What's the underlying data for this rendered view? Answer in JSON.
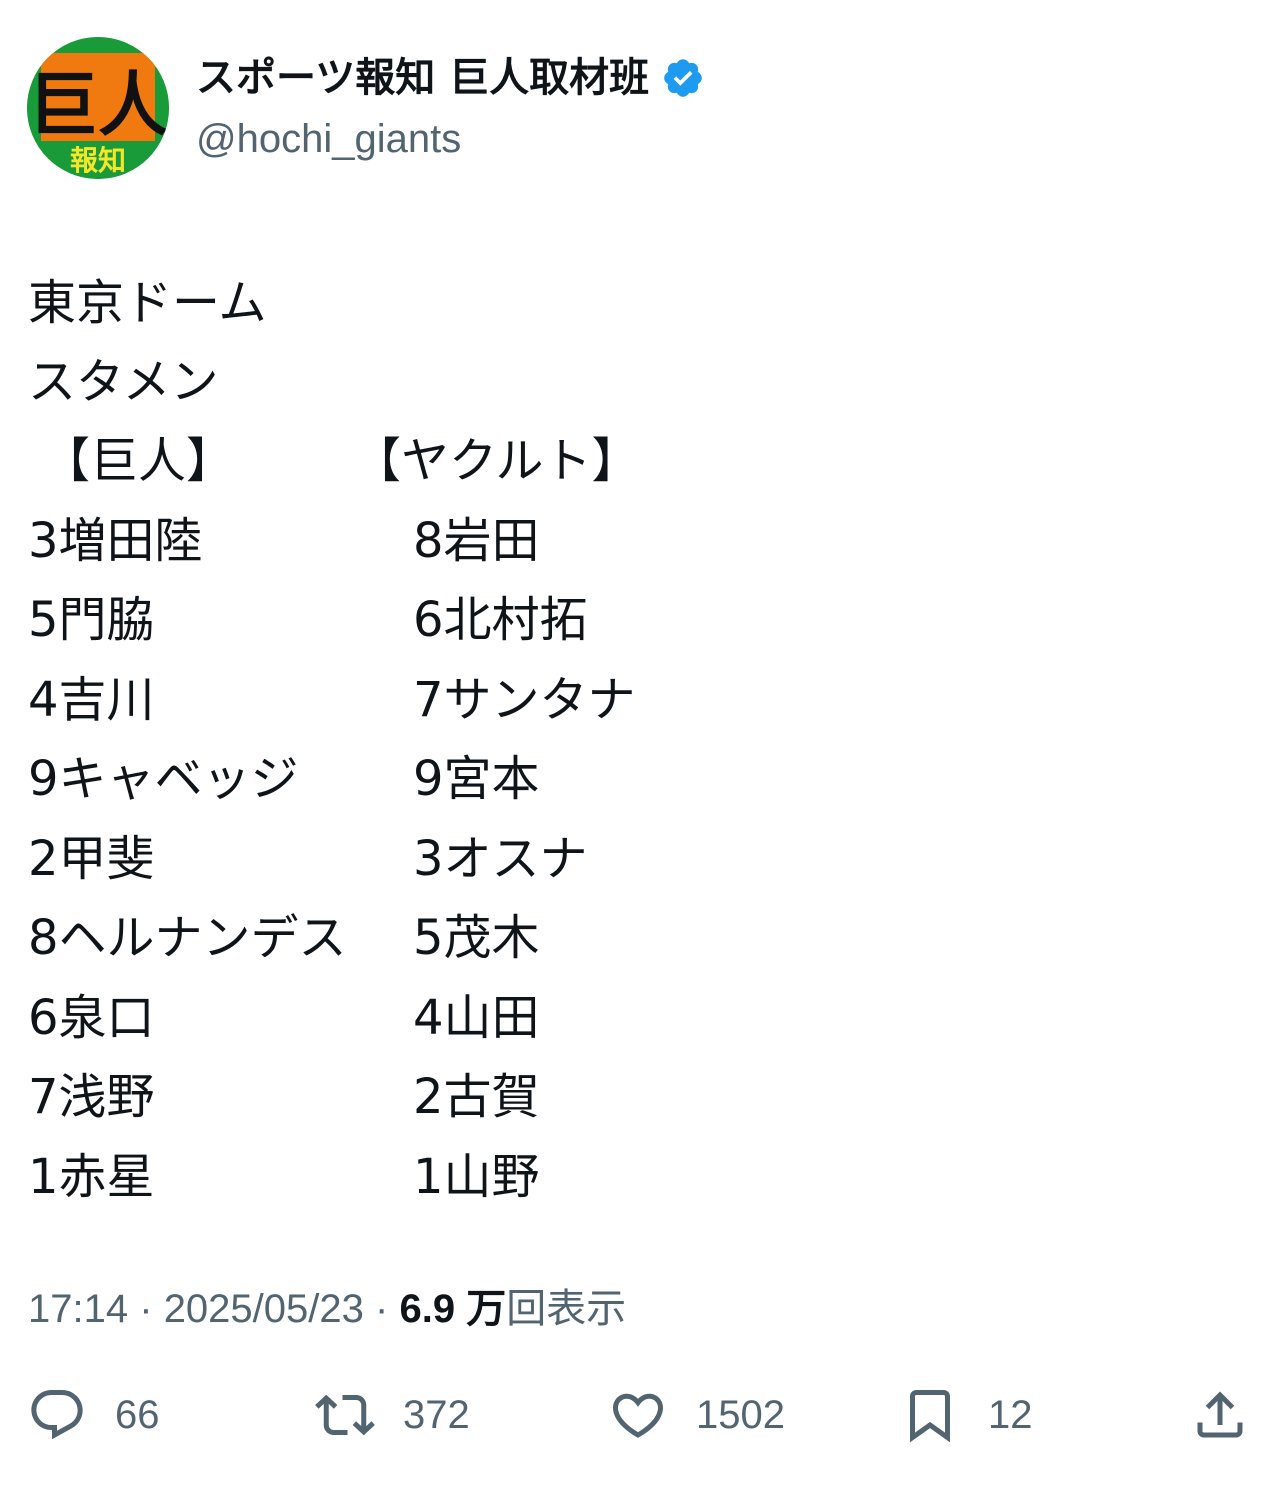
{
  "author": {
    "display_name": "スポーツ報知 巨人取材班",
    "handle": "@hochi_giants",
    "avatar_text_top": "巨人",
    "avatar_text_bottom": "報知",
    "verified": true,
    "verified_color": "#1d9bf0"
  },
  "post": {
    "lines": [
      "東京ドーム",
      "スタメン"
    ],
    "lineup": {
      "home_header": "【巨人】",
      "away_header": "【ヤクルト】",
      "home": [
        "3増田陸",
        "5門脇",
        "4吉川",
        "9キャベッジ",
        "2甲斐",
        "8ヘルナンデス",
        "6泉口",
        "7浅野",
        "1赤星"
      ],
      "away": [
        "8岩田",
        "6北村拓",
        "7サンタナ",
        "9宮本",
        "3オスナ",
        "5茂木",
        "4山田",
        "2古賀",
        "1山野"
      ]
    }
  },
  "meta": {
    "time": "17:14",
    "separator": "·",
    "date": "2025/05/23",
    "views_count": "6.9 万",
    "views_label": "回表示"
  },
  "actions": {
    "replies": "66",
    "reposts": "372",
    "likes": "1502",
    "bookmarks": "12"
  },
  "colors": {
    "text": "#0f1419",
    "secondary": "#536471",
    "avatar_green": "#1a9b3a",
    "avatar_orange": "#f07a10",
    "avatar_yellow": "#f5e62a"
  }
}
